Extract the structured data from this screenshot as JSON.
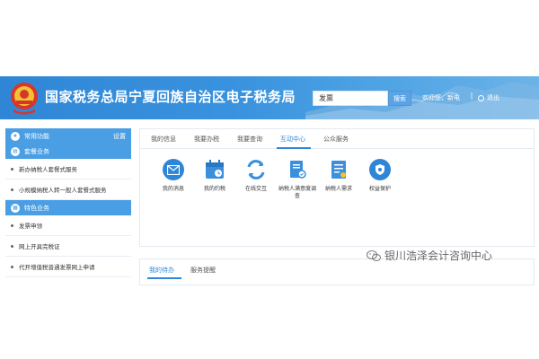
{
  "header": {
    "site_title": "国家税务总局宁夏回族自治区电子税务局",
    "search": {
      "value": "发票",
      "button_label": "搜索"
    },
    "welcome_text": "欢迎您，新电",
    "separator": "|",
    "logout_label": "退出",
    "colors": {
      "banner": "#2f86d6",
      "accent": "#4a9ee3"
    }
  },
  "sidebar": {
    "common": {
      "title": "常用功能",
      "setting": "设置"
    },
    "section1": {
      "title": "套餐业务",
      "items": [
        "新办纳税人套餐式服务",
        "小规模纳税人转一般人套餐式服务"
      ]
    },
    "section2": {
      "title": "特色业务",
      "items": [
        "发票申领",
        "网上开具完税证",
        "代开增值税普通发票网上申请"
      ]
    }
  },
  "main": {
    "tabs": [
      "我的信息",
      "我要办税",
      "我要查询",
      "互动中心",
      "公众服务"
    ],
    "active_tab": "互动中心",
    "functions": [
      {
        "label": "我的消息",
        "icon": "message-icon",
        "color": "#2f86d6"
      },
      {
        "label": "我的约税",
        "icon": "calendar-icon",
        "color": "#3b8fdc"
      },
      {
        "label": "在线交互",
        "icon": "exchange-icon",
        "color": "#3b8fdc"
      },
      {
        "label": "纳税人满意度调查",
        "icon": "survey-icon",
        "color": "#3b8fdc"
      },
      {
        "label": "纳税人需求",
        "icon": "requirement-icon",
        "color": "#3b8fdc"
      },
      {
        "label": "权益保护",
        "icon": "shield-icon",
        "color": "#2f86d6"
      }
    ]
  },
  "bottom": {
    "tabs": [
      "我的待办",
      "服务提醒"
    ],
    "active_tab": "我的待办"
  },
  "watermark": {
    "text": "银川浩泽会计咨询中心"
  }
}
